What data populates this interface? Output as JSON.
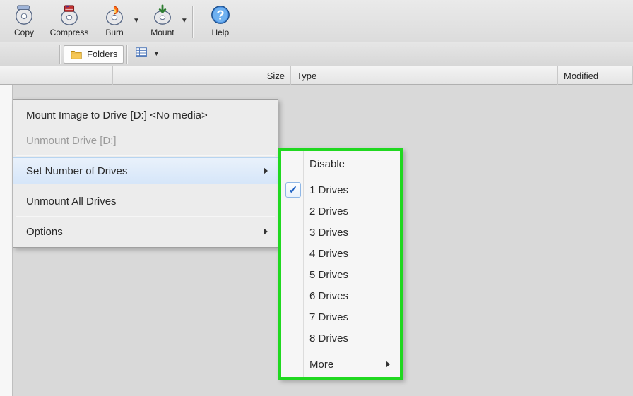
{
  "toolbar": {
    "copy": "Copy",
    "compress": "Compress",
    "burn": "Burn",
    "mount": "Mount",
    "help": "Help"
  },
  "secbar": {
    "folders": "Folders"
  },
  "columns": {
    "name": "",
    "size": "Size",
    "type": "Type",
    "modified": "Modified"
  },
  "ctx1": {
    "mount_image": "Mount Image to Drive [D:] <No media>",
    "unmount_d": "Unmount Drive [D:]",
    "set_drives": "Set Number of Drives",
    "unmount_all": "Unmount All Drives",
    "options": "Options"
  },
  "ctx2": {
    "disable": "Disable",
    "d1": "1 Drives",
    "d2": "2 Drives",
    "d3": "3 Drives",
    "d4": "4 Drives",
    "d5": "5 Drives",
    "d6": "6 Drives",
    "d7": "7 Drives",
    "d8": "8 Drives",
    "more": "More",
    "selected_index": 1
  }
}
